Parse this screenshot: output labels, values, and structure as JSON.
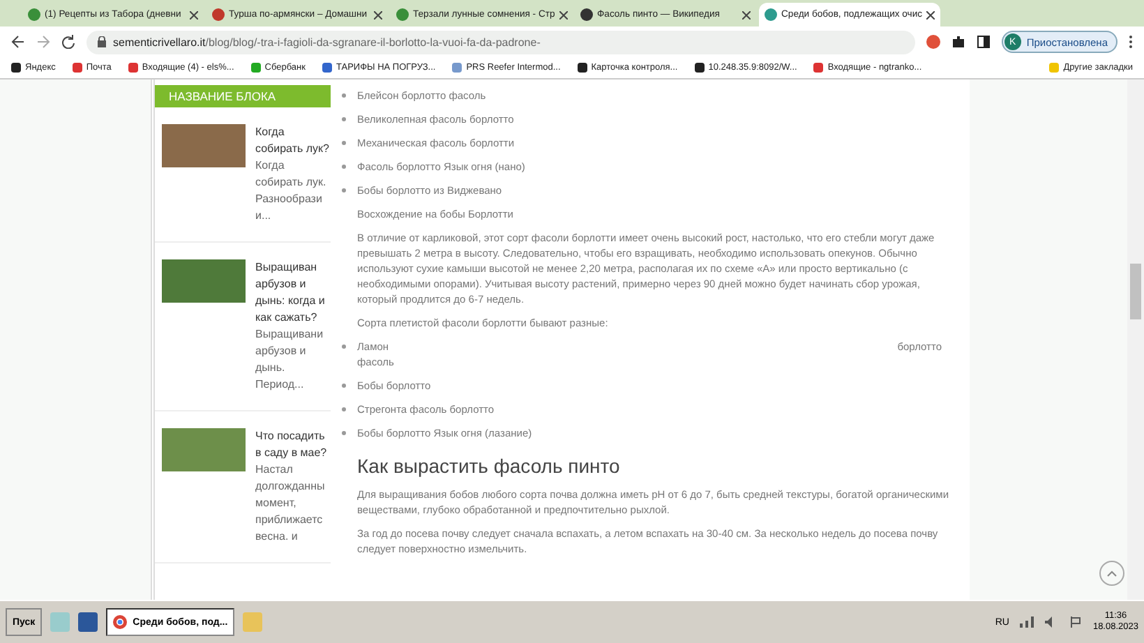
{
  "tabs": [
    {
      "title": "(1) Рецепты из Табора (дневни",
      "selected": false
    },
    {
      "title": "Турша по-армянски – Домашни",
      "selected": false
    },
    {
      "title": "Терзали лунные сомнения - Стр",
      "selected": false
    },
    {
      "title": "Фасоль пинто — Википедия",
      "selected": false
    },
    {
      "title": "Среди бобов, подлежащих очис",
      "selected": true
    }
  ],
  "address": {
    "domain": "sementicrivellaro.it",
    "path": "/blog/blog/-tra-i-fagioli-da-sgranare-il-borlotto-la-vuoi-fa-da-padrone-"
  },
  "profile": {
    "initial": "K",
    "status": "Приостановлена"
  },
  "bookmarks": [
    "Яндекс",
    "Почта",
    "Входящие (4) - els%...",
    "Сбербанк",
    "ТАРИФЫ НА ПОГРУЗ...",
    "PRS Reefer Intermod...",
    "Карточка контроля...",
    "10.248.35.9:8092/W...",
    "Входящие - ngtranko..."
  ],
  "other_bookmarks": "Другие закладки",
  "sidebar": {
    "heading": "НАЗВАНИЕ БЛОКА",
    "posts": [
      {
        "title": "Когда собирать лук?",
        "excerpt": "Когда собирать лук. Разнообрази и..."
      },
      {
        "title": "Выращиван арбузов и дынь: когда и как сажать?",
        "excerpt": "Выращивани арбузов и дынь. Период..."
      },
      {
        "title": "Что посадить в саду в мае?",
        "excerpt": "Настал долгожданны момент, приближаетс весна. и"
      }
    ]
  },
  "article": {
    "list1": [
      "Блейсон борлотто фасоль",
      "Великолепная фасоль борлотто",
      "Механическая фасоль борлотти",
      "Фасоль борлотто Язык огня (нано)",
      "Бобы борлотто из Виджевано"
    ],
    "para1": "Восхождение на бобы Борлотти",
    "para2": "В отличие от карликовой, этот сорт фасоли борлотти имеет очень высокий рост, настолько, что его стебли могут даже превышать 2 метра в высоту. Следовательно, чтобы его взращивать, необходимо использовать опекунов. Обычно используют сухие камыши высотой не менее 2,20 метра, располагая их по схеме «А» или просто вертикально (с необходимыми опорами). Учитывая высоту растений, примерно через 90 дней можно будет начинать сбор урожая, который продлится до 6-7 недель.",
    "para3": "Сорта плетистой фасоли борлотти бывают разные:",
    "list2_first": {
      "left": "Ламон",
      "right": "борлотто",
      "next": "фасоль"
    },
    "list2": [
      "Бобы борлотто",
      "Стрегонта фасоль борлотто",
      "Бобы борлотто Язык огня (лазание)"
    ],
    "heading": "Как вырастить фасоль пинто",
    "para4": "Для выращивания бобов любого сорта почва должна иметь pH от 6 до 7, быть средней текстуры, богатой органическими веществами, глубоко обработанной и предпочтительно рыхлой.",
    "para5": "За год до посева почву следует сначала вспахать, а летом вспахать на 30-40 см. За несколько недель до посева почву следует поверхностно измельчить."
  },
  "taskbar": {
    "start": "Пуск",
    "window": "Среди бобов, под...",
    "lang": "RU",
    "time": "11:36",
    "date": "18.08.2023"
  }
}
